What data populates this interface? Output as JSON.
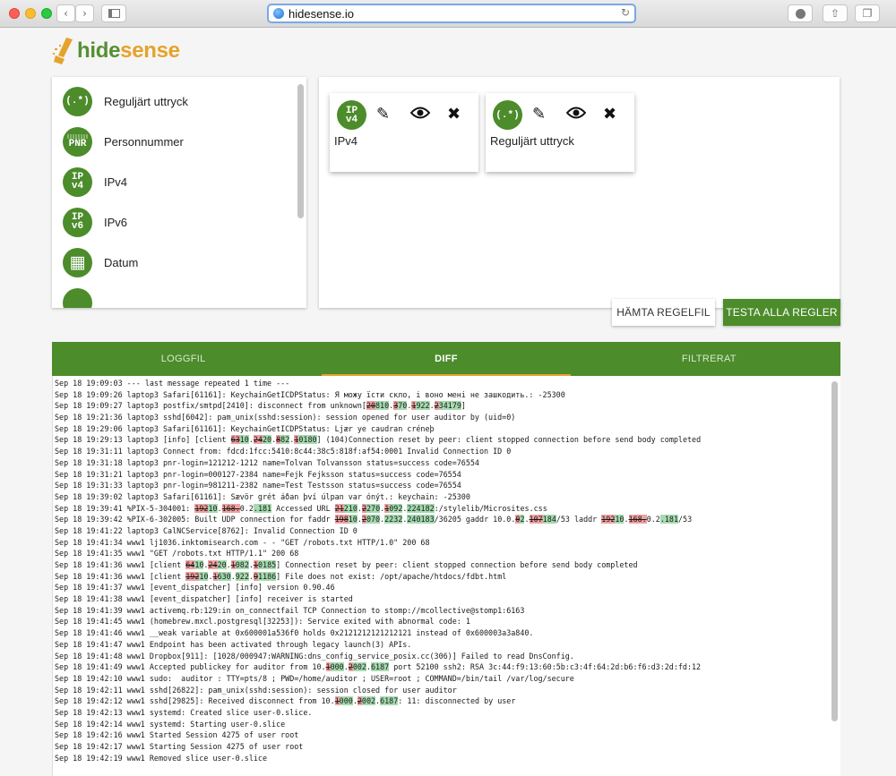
{
  "browser": {
    "url": "hidesense.io",
    "colors": {
      "close": "#fd5f57",
      "minimize": "#fdbc2e",
      "zoom": "#29c940"
    }
  },
  "logo": {
    "part1": "hide",
    "part2": "sense"
  },
  "rules": [
    {
      "icon": "regex-icon",
      "glyph": "(.*)",
      "label": "Reguljärt uttryck"
    },
    {
      "icon": "pnr-icon",
      "glyph": "PNR",
      "label": "Personnummer"
    },
    {
      "icon": "ipv4-icon",
      "glyph": "IP v4",
      "label": "IPv4"
    },
    {
      "icon": "ipv6-icon",
      "glyph": "IP v6",
      "label": "IPv6"
    },
    {
      "icon": "calendar-icon",
      "glyph": "▦",
      "label": "Datum"
    }
  ],
  "selected_rules": [
    {
      "icon": "ipv4-icon",
      "glyph": "IP v4",
      "label": "IPv4"
    },
    {
      "icon": "regex-icon",
      "glyph": "(.*)",
      "label": "Reguljärt uttryck"
    }
  ],
  "actions": {
    "edit": "✎",
    "view": "👁",
    "remove": "✖"
  },
  "buttons": {
    "fetch": "HÄMTA REGELFIL",
    "test_all": "TESTA ALLA REGLER"
  },
  "tabs": [
    "LOGGFIL",
    "DIFF",
    "FILTRERAT"
  ],
  "active_tab": "DIFF",
  "accent_colors": {
    "green": "#4c8c2b",
    "orange": "#e5a32a",
    "deleted": "#f2a0a0",
    "inserted": "#a6dbb0"
  },
  "log_lines": [
    [
      [
        "t",
        "Sep 18 19:09:03 --- last message repeated 1 time ---"
      ]
    ],
    [
      [
        "t",
        "Sep 18 19:09:26 laptop3 Safari[61161]: KeychainGetICDPStatus: Я можу їсти скло, і воно мені не зашкодить.: -25300"
      ]
    ],
    [
      [
        "t",
        "Sep 18 19:09:27 laptop3 postfix/smtpd[2410]: disconnect from unknown["
      ],
      [
        "d",
        "20"
      ],
      [
        "i",
        "810"
      ],
      [
        "t",
        "."
      ],
      [
        "d",
        "3"
      ],
      [
        "i",
        "70"
      ],
      [
        "t",
        "."
      ],
      [
        "d",
        "1"
      ],
      [
        "i",
        "922"
      ],
      [
        "t",
        "."
      ],
      [
        "d",
        "2"
      ],
      [
        "i",
        "34179"
      ],
      [
        "t",
        "]"
      ]
    ],
    [
      [
        "t",
        "Sep 18 19:21:36 laptop3 sshd[6042]: pam_unix(sshd:session): session opened for user auditor by (uid=0)"
      ]
    ],
    [
      [
        "t",
        "Sep 18 19:29:06 laptop3 Safari[61161]: KeychainGetICDPStatus: Ljær ye caudran créneþ"
      ]
    ],
    [
      [
        "t",
        "Sep 18 19:29:13 laptop3 [info] [client "
      ],
      [
        "d",
        "63"
      ],
      [
        "i",
        "10"
      ],
      [
        "t",
        "."
      ],
      [
        "d",
        "24"
      ],
      [
        "i",
        "20"
      ],
      [
        "t",
        "."
      ],
      [
        "d",
        "8"
      ],
      [
        "i",
        "82"
      ],
      [
        "t",
        "."
      ],
      [
        "d",
        "1"
      ],
      [
        "i",
        "0180"
      ],
      [
        "t",
        "] (104)Connection reset by peer: client stopped connection before send body completed"
      ]
    ],
    [
      [
        "t",
        "Sep 18 19:31:11 laptop3 Connect from: fdcd:1fcc:5410:8c44:38c5:818f:af54:0001 Invalid Connection ID 0"
      ]
    ],
    [
      [
        "t",
        "Sep 18 19:31:18 laptop3 pnr-login=121212-1212 name=Tolvan Tolvansson status=success code=76554"
      ]
    ],
    [
      [
        "t",
        "Sep 18 19:31:21 laptop3 pnr-login=000127-2384 name=Fejk Fejksson status=success code=76554"
      ]
    ],
    [
      [
        "t",
        "Sep 18 19:31:33 laptop3 pnr-login=981211-2382 name=Test Testsson status=success code=76554"
      ]
    ],
    [
      [
        "t",
        "Sep 18 19:39:02 laptop3 Safari[61161]: Sævör grét áðan því úlpan var ónýt.: keychain: -25300"
      ]
    ],
    [
      [
        "t",
        "Sep 18 19:39:41 %PIX-5-304001: "
      ],
      [
        "d",
        "192"
      ],
      [
        "i",
        "10"
      ],
      [
        "t",
        "."
      ],
      [
        "d",
        "168."
      ],
      [
        "t",
        "0.2"
      ],
      [
        "i",
        ".181"
      ],
      [
        "t",
        " Accessed URL "
      ],
      [
        "d",
        "21"
      ],
      [
        "i",
        "210"
      ],
      [
        "t",
        "."
      ],
      [
        "d",
        "2"
      ],
      [
        "i",
        "270"
      ],
      [
        "t",
        "."
      ],
      [
        "d",
        "1"
      ],
      [
        "i",
        "092"
      ],
      [
        "t",
        "."
      ],
      [
        "i",
        "224182"
      ],
      [
        "t",
        ":/stylelib/Microsites.css"
      ]
    ],
    [
      [
        "t",
        "Sep 18 19:39:42 %PIX-6-302005: Built UDP connection for faddr "
      ],
      [
        "d",
        "198"
      ],
      [
        "i",
        "10"
      ],
      [
        "t",
        "."
      ],
      [
        "d",
        "2"
      ],
      [
        "i",
        "070"
      ],
      [
        "t",
        "."
      ],
      [
        "i",
        "2232"
      ],
      [
        "t",
        "."
      ],
      [
        "i",
        "240183"
      ],
      [
        "t",
        "/36205 gaddr 10.0."
      ],
      [
        "d",
        "0"
      ],
      [
        "i",
        "2"
      ],
      [
        "t",
        "."
      ],
      [
        "d",
        "107"
      ],
      [
        "i",
        "184"
      ],
      [
        "t",
        "/53 laddr "
      ],
      [
        "d",
        "192"
      ],
      [
        "i",
        "10"
      ],
      [
        "t",
        "."
      ],
      [
        "d",
        "168."
      ],
      [
        "t",
        "0.2"
      ],
      [
        "i",
        ".181"
      ],
      [
        "t",
        "/53"
      ]
    ],
    [
      [
        "t",
        "Sep 18 19:41:22 laptop3 CalNCService[8762]: Invalid Connection ID 0"
      ]
    ],
    [
      [
        "t",
        "Sep 18 19:41:34 www1 lj1036.inktomisearch.com - - \"GET /robots.txt HTTP/1.0\" 200 68"
      ]
    ],
    [
      [
        "t",
        "Sep 18 19:41:35 www1 \"GET /robots.txt HTTP/1.1\" 200 68"
      ]
    ],
    [
      [
        "t",
        "Sep 18 19:41:36 www1 [client "
      ],
      [
        "d",
        "64"
      ],
      [
        "i",
        "10"
      ],
      [
        "t",
        "."
      ],
      [
        "d",
        "24"
      ],
      [
        "i",
        "20"
      ],
      [
        "t",
        "."
      ],
      [
        "d",
        "1"
      ],
      [
        "i",
        "082"
      ],
      [
        "t",
        "."
      ],
      [
        "d",
        "1"
      ],
      [
        "i",
        "0185"
      ],
      [
        "t",
        "] Connection reset by peer: client stopped connection before send body completed"
      ]
    ],
    [
      [
        "t",
        "Sep 18 19:41:36 www1 [client "
      ],
      [
        "d",
        "192"
      ],
      [
        "i",
        "10"
      ],
      [
        "t",
        "."
      ],
      [
        "d",
        "1"
      ],
      [
        "i",
        "630"
      ],
      [
        "t",
        "."
      ],
      [
        "i",
        "922"
      ],
      [
        "t",
        "."
      ],
      [
        "d",
        "9"
      ],
      [
        "i",
        "1186"
      ],
      [
        "t",
        "] File does not exist: /opt/apache/htdocs/fdbt.html"
      ]
    ],
    [
      [
        "t",
        "Sep 18 19:41:37 www1 [event_dispatcher] [info] version 0.90.46"
      ]
    ],
    [
      [
        "t",
        "Sep 18 19:41:38 www1 [event_dispatcher] [info] receiver is started"
      ]
    ],
    [
      [
        "t",
        "Sep 18 19:41:39 www1 activemq.rb:129:in on_connectfail TCP Connection to stomp://mcollective@stomp1:6163"
      ]
    ],
    [
      [
        "t",
        "Sep 18 19:41:45 www1 (homebrew.mxcl.postgresql[32253]): Service exited with abnormal code: 1"
      ]
    ],
    [
      [
        "t",
        "Sep 18 19:41:46 www1 __weak variable at 0x600001a536f0 holds 0x2121212121212121 instead of 0x600003a3a840."
      ]
    ],
    [
      [
        "t",
        "Sep 18 19:41:47 www1 Endpoint has been activated through legacy launch(3) APIs."
      ]
    ],
    [
      [
        "t",
        "Sep 18 19:41:48 www1 Dropbox[911]: [1028/000947:WARNING:dns_config_service_posix.cc(306)] Failed to read DnsConfig."
      ]
    ],
    [
      [
        "t",
        "Sep 18 19:41:49 www1 Accepted publickey for auditor from 10."
      ],
      [
        "d",
        "1"
      ],
      [
        "i",
        "000"
      ],
      [
        "t",
        "."
      ],
      [
        "d",
        "2"
      ],
      [
        "i",
        "002"
      ],
      [
        "t",
        "."
      ],
      [
        "i",
        "6187"
      ],
      [
        "t",
        " port 52100 ssh2: RSA 3c:44:f9:13:60:5b:c3:4f:64:2d:b6:f6:d3:2d:fd:12"
      ]
    ],
    [
      [
        "t",
        "Sep 18 19:42:10 www1 sudo:  auditor : TTY=pts/8 ; PWD=/home/auditor ; USER=root ; COMMAND=/bin/tail /var/log/secure"
      ]
    ],
    [
      [
        "t",
        "Sep 18 19:42:11 www1 sshd[26822]: pam_unix(sshd:session): session closed for user auditor"
      ]
    ],
    [
      [
        "t",
        "Sep 18 19:42:12 www1 sshd[29825]: Received disconnect from 10."
      ],
      [
        "d",
        "1"
      ],
      [
        "i",
        "000"
      ],
      [
        "t",
        "."
      ],
      [
        "d",
        "2"
      ],
      [
        "i",
        "002"
      ],
      [
        "t",
        "."
      ],
      [
        "i",
        "6187"
      ],
      [
        "t",
        ": 11: disconnected by user"
      ]
    ],
    [
      [
        "t",
        "Sep 18 19:42:13 www1 systemd: Created slice user-0.slice."
      ]
    ],
    [
      [
        "t",
        "Sep 18 19:42:14 www1 systemd: Starting user-0.slice"
      ]
    ],
    [
      [
        "t",
        "Sep 18 19:42:16 www1 Started Session 4275 of user root"
      ]
    ],
    [
      [
        "t",
        "Sep 18 19:42:17 www1 Starting Session 4275 of user root"
      ]
    ],
    [
      [
        "t",
        "Sep 18 19:42:19 www1 Removed slice user-0.slice"
      ]
    ]
  ]
}
